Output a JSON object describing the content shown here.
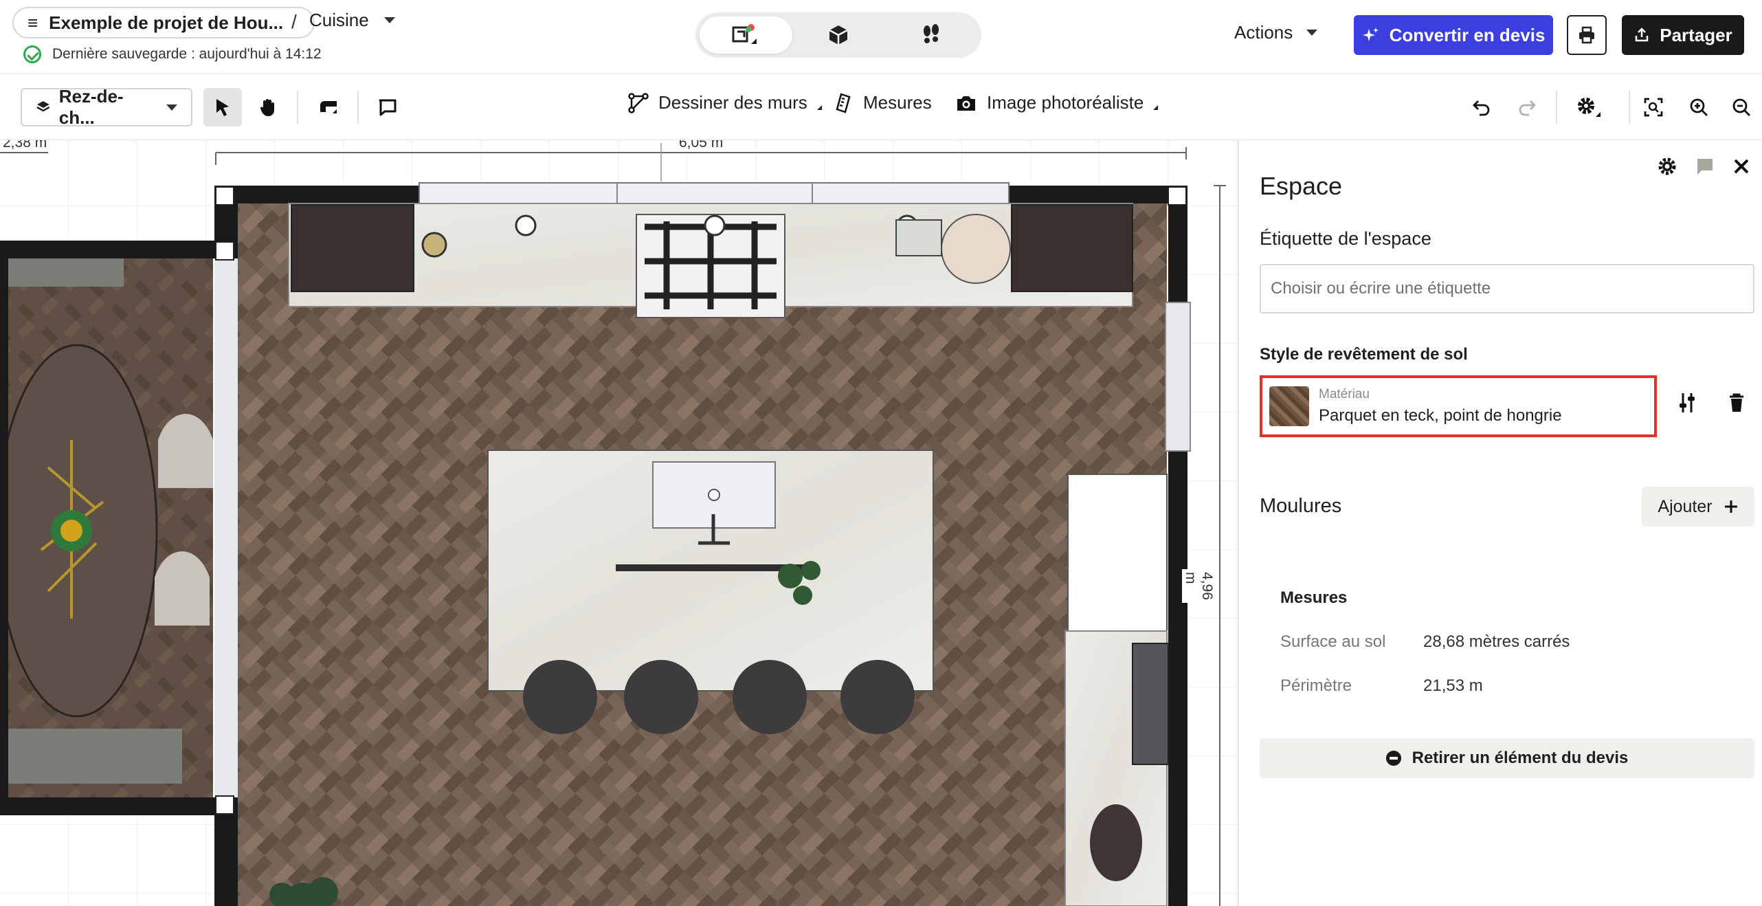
{
  "header": {
    "project_name": "Exemple de projet de Hou...",
    "separator": "/",
    "room": "Cuisine",
    "save_status": "Dernière sauvegarde : aujourd'hui à 14:12",
    "actions_label": "Actions",
    "convert_label": "Convertir en devis",
    "share_label": "Partager",
    "view_modes": [
      "floorplan-2d",
      "view-3d",
      "walkthrough"
    ],
    "active_view": "floorplan-2d",
    "colors": {
      "convert": "#3b3fe0",
      "share": "#1a1a1a",
      "highlight": "#e0322a"
    }
  },
  "toolbar": {
    "floor": "Rez-de-ch...",
    "draw_walls": "Dessiner des murs",
    "measures": "Mesures",
    "photo_image": "Image photoréaliste"
  },
  "canvas": {
    "dim_left": "2,38 m",
    "dim_top": "6,05 m",
    "dim_right": "4,96 m"
  },
  "panel": {
    "title": "Espace",
    "tag_label": "Étiquette de l'espace",
    "tag_placeholder": "Choisir ou écrire une étiquette",
    "floor_style_label": "Style de revêtement de sol",
    "material_caption": "Matériau",
    "material_value": "Parquet en teck, point de hongrie",
    "moldings_label": "Moulures",
    "add_label": "Ajouter",
    "measures_title": "Mesures",
    "floor_area_label": "Surface au sol",
    "floor_area_value": "28,68 mètres carrés",
    "perimeter_label": "Périmètre",
    "perimeter_value": "21,53 m",
    "remove_label": "Retirer un élément du devis"
  }
}
